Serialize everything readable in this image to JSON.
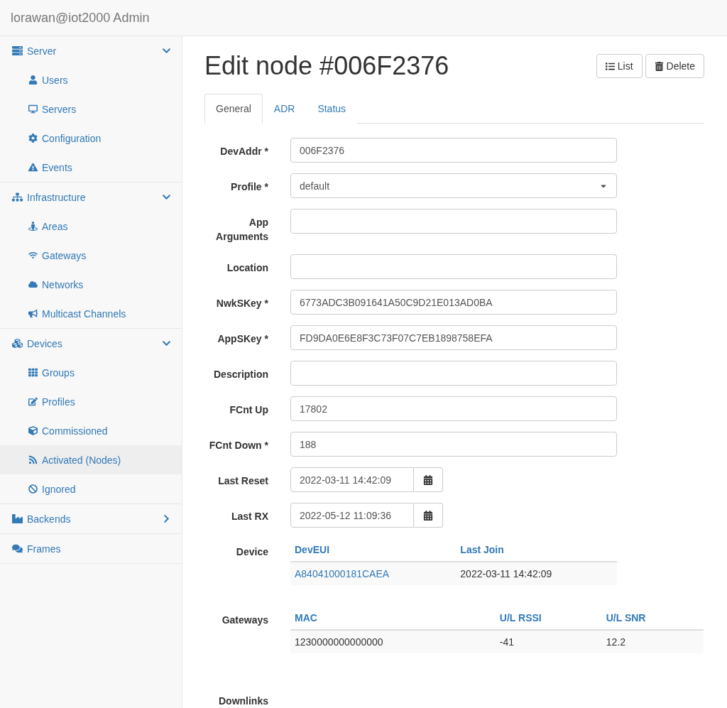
{
  "header": {
    "title": "lorawan@iot2000 Admin"
  },
  "sidebar": {
    "groups": [
      {
        "label": "Server",
        "expanded": true,
        "items": [
          {
            "label": "Users",
            "selected": false
          },
          {
            "label": "Servers",
            "selected": false
          },
          {
            "label": "Configuration",
            "selected": false
          },
          {
            "label": "Events",
            "selected": false
          }
        ]
      },
      {
        "label": "Infrastructure",
        "expanded": true,
        "items": [
          {
            "label": "Areas",
            "selected": false
          },
          {
            "label": "Gateways",
            "selected": false
          },
          {
            "label": "Networks",
            "selected": false
          },
          {
            "label": "Multicast Channels",
            "selected": false
          }
        ]
      },
      {
        "label": "Devices",
        "expanded": true,
        "items": [
          {
            "label": "Groups",
            "selected": false
          },
          {
            "label": "Profiles",
            "selected": false
          },
          {
            "label": "Commissioned",
            "selected": false
          },
          {
            "label": "Activated (Nodes)",
            "selected": true
          },
          {
            "label": "Ignored",
            "selected": false
          }
        ]
      },
      {
        "label": "Backends",
        "expanded": false
      },
      {
        "label": "Frames"
      }
    ]
  },
  "page": {
    "title": "Edit node #006F2376",
    "buttons": [
      "List",
      "Delete"
    ]
  },
  "tabs": [
    {
      "label": "General",
      "selected": true
    },
    {
      "label": "ADR",
      "selected": false
    },
    {
      "label": "Status",
      "selected": false
    }
  ],
  "fields": [
    {
      "kind": "text",
      "label": "DevAddr *",
      "value": "006F2376"
    },
    {
      "kind": "select",
      "label": "Profile *",
      "value": "default"
    },
    {
      "kind": "text",
      "label": "App Arguments"
    },
    {
      "kind": "text",
      "label": "Location"
    },
    {
      "kind": "text",
      "label": "NwkSKey *",
      "value": "6773ADC3B091641A50C9D21E013AD0BA"
    },
    {
      "kind": "text",
      "label": "AppSKey *",
      "value": "FD9DA0E6E8F3C73F07C7EB1898758EFA"
    },
    {
      "kind": "text",
      "label": "Description"
    },
    {
      "kind": "text",
      "label": "FCnt Up",
      "value": "17802"
    },
    {
      "kind": "text",
      "label": "FCnt Down *",
      "value": "188"
    },
    {
      "kind": "date",
      "label": "Last Reset",
      "value": "2022-03-11 14:42:09"
    },
    {
      "kind": "date",
      "label": "Last RX",
      "value": "2022-05-12 11:09:36"
    }
  ],
  "device": {
    "label": "Device",
    "columns": [
      "DevEUI",
      "Last Join"
    ],
    "rows": [
      [
        "A84041000181CAEA",
        "2022-03-11 14:42:09"
      ]
    ]
  },
  "gateways": {
    "label": "Gateways",
    "columns": [
      "MAC",
      "U/L RSSI",
      "U/L SNR"
    ],
    "rows": [
      [
        "1230000000000000",
        "-41",
        "12.2"
      ]
    ]
  },
  "downlinks": {
    "label": "Downlinks"
  }
}
